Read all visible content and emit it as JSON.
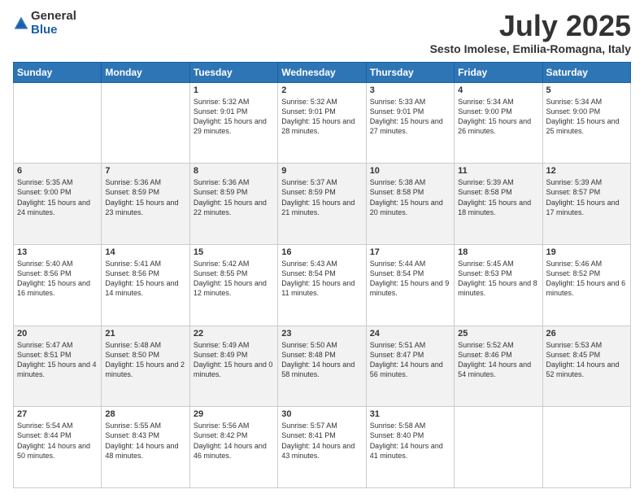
{
  "logo": {
    "general": "General",
    "blue": "Blue"
  },
  "title": {
    "month": "July 2025",
    "location": "Sesto Imolese, Emilia-Romagna, Italy"
  },
  "days": [
    "Sunday",
    "Monday",
    "Tuesday",
    "Wednesday",
    "Thursday",
    "Friday",
    "Saturday"
  ],
  "weeks": [
    [
      {
        "day": "",
        "content": ""
      },
      {
        "day": "",
        "content": ""
      },
      {
        "day": "1",
        "content": "Sunrise: 5:32 AM\nSunset: 9:01 PM\nDaylight: 15 hours and 29 minutes."
      },
      {
        "day": "2",
        "content": "Sunrise: 5:32 AM\nSunset: 9:01 PM\nDaylight: 15 hours and 28 minutes."
      },
      {
        "day": "3",
        "content": "Sunrise: 5:33 AM\nSunset: 9:01 PM\nDaylight: 15 hours and 27 minutes."
      },
      {
        "day": "4",
        "content": "Sunrise: 5:34 AM\nSunset: 9:00 PM\nDaylight: 15 hours and 26 minutes."
      },
      {
        "day": "5",
        "content": "Sunrise: 5:34 AM\nSunset: 9:00 PM\nDaylight: 15 hours and 25 minutes."
      }
    ],
    [
      {
        "day": "6",
        "content": "Sunrise: 5:35 AM\nSunset: 9:00 PM\nDaylight: 15 hours and 24 minutes."
      },
      {
        "day": "7",
        "content": "Sunrise: 5:36 AM\nSunset: 8:59 PM\nDaylight: 15 hours and 23 minutes."
      },
      {
        "day": "8",
        "content": "Sunrise: 5:36 AM\nSunset: 8:59 PM\nDaylight: 15 hours and 22 minutes."
      },
      {
        "day": "9",
        "content": "Sunrise: 5:37 AM\nSunset: 8:59 PM\nDaylight: 15 hours and 21 minutes."
      },
      {
        "day": "10",
        "content": "Sunrise: 5:38 AM\nSunset: 8:58 PM\nDaylight: 15 hours and 20 minutes."
      },
      {
        "day": "11",
        "content": "Sunrise: 5:39 AM\nSunset: 8:58 PM\nDaylight: 15 hours and 18 minutes."
      },
      {
        "day": "12",
        "content": "Sunrise: 5:39 AM\nSunset: 8:57 PM\nDaylight: 15 hours and 17 minutes."
      }
    ],
    [
      {
        "day": "13",
        "content": "Sunrise: 5:40 AM\nSunset: 8:56 PM\nDaylight: 15 hours and 16 minutes."
      },
      {
        "day": "14",
        "content": "Sunrise: 5:41 AM\nSunset: 8:56 PM\nDaylight: 15 hours and 14 minutes."
      },
      {
        "day": "15",
        "content": "Sunrise: 5:42 AM\nSunset: 8:55 PM\nDaylight: 15 hours and 12 minutes."
      },
      {
        "day": "16",
        "content": "Sunrise: 5:43 AM\nSunset: 8:54 PM\nDaylight: 15 hours and 11 minutes."
      },
      {
        "day": "17",
        "content": "Sunrise: 5:44 AM\nSunset: 8:54 PM\nDaylight: 15 hours and 9 minutes."
      },
      {
        "day": "18",
        "content": "Sunrise: 5:45 AM\nSunset: 8:53 PM\nDaylight: 15 hours and 8 minutes."
      },
      {
        "day": "19",
        "content": "Sunrise: 5:46 AM\nSunset: 8:52 PM\nDaylight: 15 hours and 6 minutes."
      }
    ],
    [
      {
        "day": "20",
        "content": "Sunrise: 5:47 AM\nSunset: 8:51 PM\nDaylight: 15 hours and 4 minutes."
      },
      {
        "day": "21",
        "content": "Sunrise: 5:48 AM\nSunset: 8:50 PM\nDaylight: 15 hours and 2 minutes."
      },
      {
        "day": "22",
        "content": "Sunrise: 5:49 AM\nSunset: 8:49 PM\nDaylight: 15 hours and 0 minutes."
      },
      {
        "day": "23",
        "content": "Sunrise: 5:50 AM\nSunset: 8:48 PM\nDaylight: 14 hours and 58 minutes."
      },
      {
        "day": "24",
        "content": "Sunrise: 5:51 AM\nSunset: 8:47 PM\nDaylight: 14 hours and 56 minutes."
      },
      {
        "day": "25",
        "content": "Sunrise: 5:52 AM\nSunset: 8:46 PM\nDaylight: 14 hours and 54 minutes."
      },
      {
        "day": "26",
        "content": "Sunrise: 5:53 AM\nSunset: 8:45 PM\nDaylight: 14 hours and 52 minutes."
      }
    ],
    [
      {
        "day": "27",
        "content": "Sunrise: 5:54 AM\nSunset: 8:44 PM\nDaylight: 14 hours and 50 minutes."
      },
      {
        "day": "28",
        "content": "Sunrise: 5:55 AM\nSunset: 8:43 PM\nDaylight: 14 hours and 48 minutes."
      },
      {
        "day": "29",
        "content": "Sunrise: 5:56 AM\nSunset: 8:42 PM\nDaylight: 14 hours and 46 minutes."
      },
      {
        "day": "30",
        "content": "Sunrise: 5:57 AM\nSunset: 8:41 PM\nDaylight: 14 hours and 43 minutes."
      },
      {
        "day": "31",
        "content": "Sunrise: 5:58 AM\nSunset: 8:40 PM\nDaylight: 14 hours and 41 minutes."
      },
      {
        "day": "",
        "content": ""
      },
      {
        "day": "",
        "content": ""
      }
    ]
  ]
}
